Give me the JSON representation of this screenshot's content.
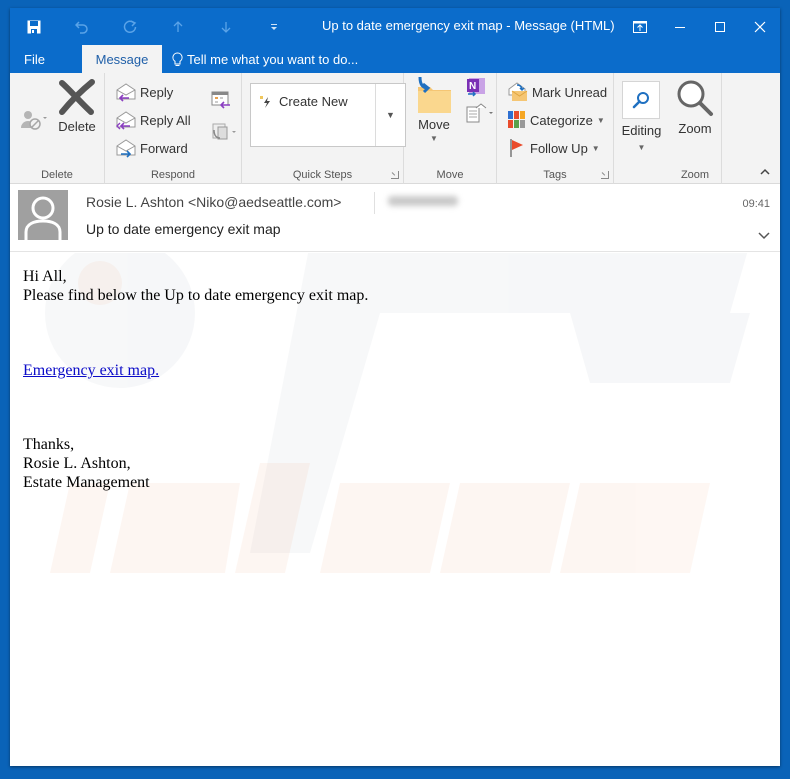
{
  "window": {
    "title": "Up to date emergency exit map - Message (HTML)"
  },
  "quick_access": {
    "items": [
      "save",
      "undo",
      "redo",
      "previous-item",
      "next-item",
      "customize"
    ]
  },
  "tabs": {
    "file": "File",
    "message": "Message",
    "tell_me": "Tell me what you want to do..."
  },
  "ribbon": {
    "delete_group": {
      "label": "Delete",
      "delete": "Delete"
    },
    "respond_group": {
      "label": "Respond",
      "reply": "Reply",
      "reply_all": "Reply All",
      "forward": "Forward"
    },
    "quick_steps_group": {
      "label": "Quick Steps",
      "create_new": "Create New"
    },
    "move_group": {
      "label": "Move",
      "move": "Move"
    },
    "tags_group": {
      "label": "Tags",
      "mark_unread": "Mark Unread",
      "categorize": "Categorize",
      "follow_up": "Follow Up"
    },
    "editing_group": {
      "editing": "Editing"
    },
    "zoom_group": {
      "label": "Zoom",
      "zoom": "Zoom"
    }
  },
  "message": {
    "sender": "Rosie L. Ashton <Niko@aedseattle.com>",
    "time": "09:41",
    "subject": "Up to date emergency exit map",
    "body": {
      "greeting": "Hi All,",
      "line1": "Please find below the Up to date emergency exit map.",
      "link_text": "Emergency exit map.",
      "closing": "Thanks,",
      "signature_name": "Rosie L. Ashton,",
      "signature_dept": "Estate Management"
    }
  },
  "colors": {
    "accent": "#0b6ccb",
    "bezel": "#0a63b8",
    "ribbon_bg": "#f3f3f3",
    "link": "#0b0bc8"
  }
}
